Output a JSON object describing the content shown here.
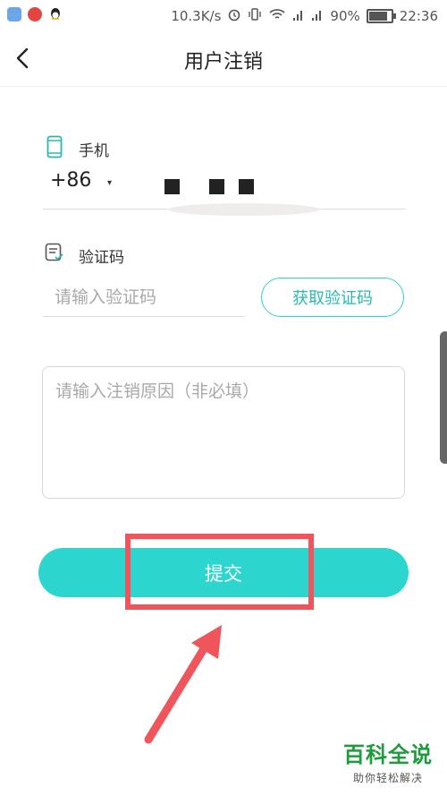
{
  "status_bar": {
    "network_speed": "10.3K/s",
    "battery_text": "90%",
    "battery_level": 0.9,
    "time": "22:36",
    "icons": [
      "shield-app-icon",
      "netease-music-icon",
      "qq-icon",
      "alarm-icon",
      "vibrate-icon",
      "wifi-icon",
      "signal-icon",
      "signal-icon-2",
      "battery-icon"
    ]
  },
  "header": {
    "title": "用户注销",
    "back_icon": "chevron-left-icon"
  },
  "phone": {
    "label": "手机",
    "icon": "phone-icon",
    "country_code": "+86",
    "dropdown_arrow": "▾"
  },
  "verify": {
    "label": "验证码",
    "icon": "checklist-icon",
    "placeholder": "请输入验证码",
    "get_code_label": "获取验证码"
  },
  "reason": {
    "placeholder": "请输入注销原因（非必填）"
  },
  "submit": {
    "label": "提交"
  },
  "colors": {
    "accent": "#2cd6ce",
    "annotation": "#f0555c",
    "watermark": "#1e9b3d"
  },
  "watermark": {
    "title": "百科全说",
    "subtitle": "助你轻松解决"
  }
}
